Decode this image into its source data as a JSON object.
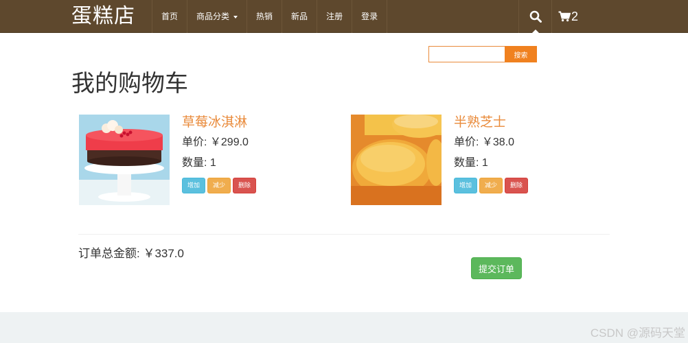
{
  "brand": "蛋糕店",
  "nav": {
    "items": [
      {
        "label": "首页"
      },
      {
        "label": "商品分类"
      },
      {
        "label": "热销"
      },
      {
        "label": "新品"
      },
      {
        "label": "注册"
      },
      {
        "label": "登录"
      }
    ],
    "cart_count": "2"
  },
  "search": {
    "value": "",
    "button_label": "搜索"
  },
  "page_title": "我的购物车",
  "products": [
    {
      "name": "草莓冰淇淋",
      "price_text": "单价: ￥299.0",
      "qty_text": "数量: 1",
      "add_label": "增加",
      "reduce_label": "减少",
      "delete_label": "删除"
    },
    {
      "name": "半熟芝士",
      "price_text": "单价: ￥38.0",
      "qty_text": "数量: 1",
      "add_label": "增加",
      "reduce_label": "减少",
      "delete_label": "删除"
    }
  ],
  "order_total_text": "订单总金额: ￥337.0",
  "submit_label": "提交订单",
  "watermark": "CSDN @源码天堂",
  "colors": {
    "navbar": "#5e482d",
    "accent_orange": "#f0811f",
    "product_name": "#e98a3a",
    "success": "#5cb85c",
    "info": "#5bc0de",
    "warning": "#f0ad4e",
    "danger": "#d9534f"
  }
}
